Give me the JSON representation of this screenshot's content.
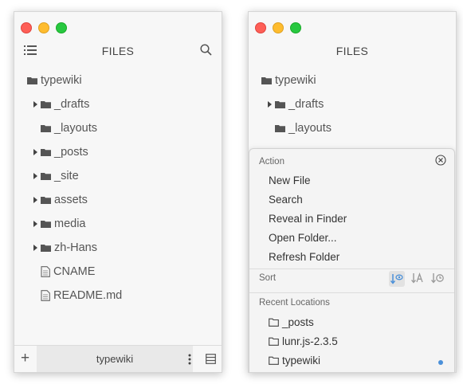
{
  "left_window": {
    "title": "FILES",
    "root": "typewiki",
    "items": [
      {
        "label": "_drafts",
        "type": "folder",
        "expandable": true
      },
      {
        "label": "_layouts",
        "type": "folder",
        "expandable": false
      },
      {
        "label": "_posts",
        "type": "folder",
        "expandable": true
      },
      {
        "label": "_site",
        "type": "folder",
        "expandable": true
      },
      {
        "label": "assets",
        "type": "folder",
        "expandable": true
      },
      {
        "label": "media",
        "type": "folder",
        "expandable": true
      },
      {
        "label": "zh-Hans",
        "type": "folder",
        "expandable": true
      },
      {
        "label": "CNAME",
        "type": "file",
        "expandable": false
      },
      {
        "label": "README.md",
        "type": "file",
        "expandable": false
      }
    ],
    "bottom": {
      "add": "+",
      "workspace": "typewiki"
    }
  },
  "right_window": {
    "title": "FILES",
    "root": "typewiki",
    "items": [
      {
        "label": "_drafts",
        "type": "folder",
        "expandable": true
      },
      {
        "label": "_layouts",
        "type": "folder",
        "expandable": false
      }
    ],
    "popup": {
      "action_label": "Action",
      "actions": [
        "New File",
        "Search",
        "Reveal in Finder",
        "Open Folder...",
        "Refresh Folder"
      ],
      "sort_label": "Sort",
      "recent_label": "Recent Locations",
      "recent": [
        {
          "label": "_posts",
          "current": false
        },
        {
          "label": "lunr.js-2.3.5",
          "current": false
        },
        {
          "label": "typewiki",
          "current": true
        }
      ]
    }
  },
  "colors": {
    "accent": "#4a90d9",
    "folder": "#555555"
  }
}
